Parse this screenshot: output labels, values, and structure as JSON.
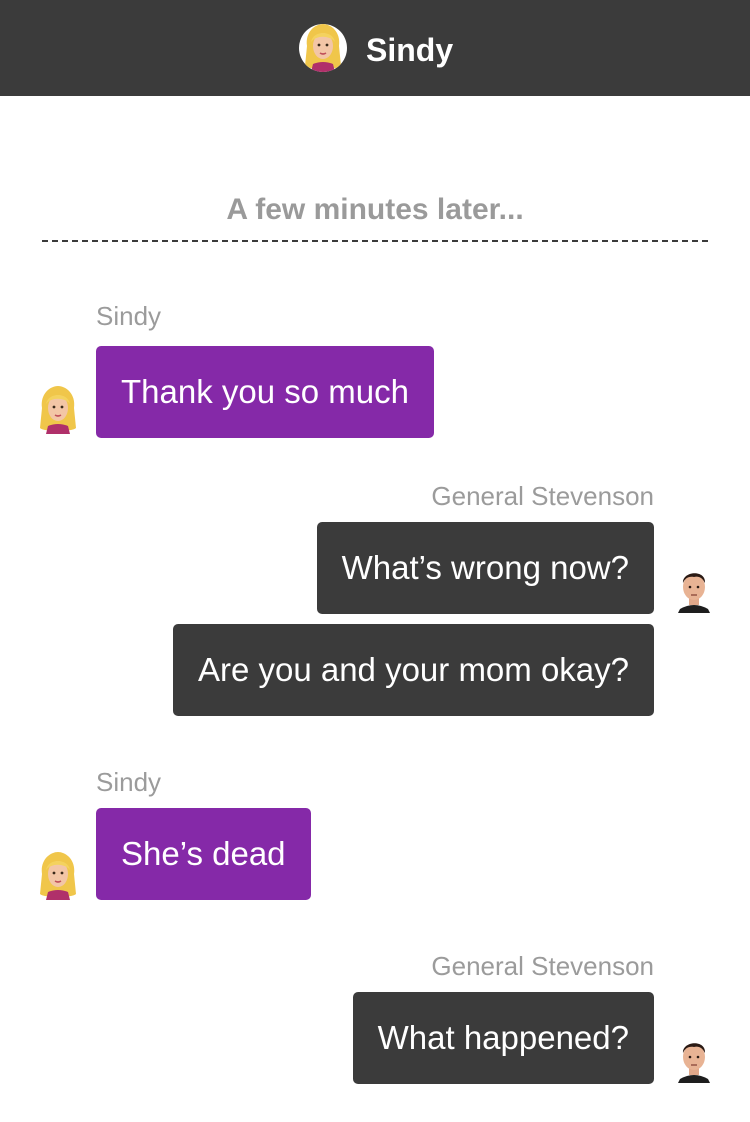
{
  "header": {
    "title": "Sindy"
  },
  "divider": {
    "label": "A few minutes later..."
  },
  "messages": [
    {
      "sender": "Sindy",
      "text": "Thank you so much"
    },
    {
      "sender": "General Stevenson",
      "text": "What’s wrong now?"
    },
    {
      "text": "Are you and your mom okay?"
    },
    {
      "sender": "Sindy",
      "text": "She’s dead"
    },
    {
      "sender": "General Stevenson",
      "text": "What happened?"
    }
  ],
  "colors": {
    "header_bg": "#3b3b3b",
    "sindy_bubble": "#8529a8",
    "general_bubble": "#3b3b3b",
    "sender_label": "#9b9b9b",
    "divider_text": "#9a9a9a"
  },
  "icons": {
    "sindy_avatar": "blonde-woman-avatar-icon",
    "general_avatar": "dark-haired-man-avatar-icon"
  }
}
